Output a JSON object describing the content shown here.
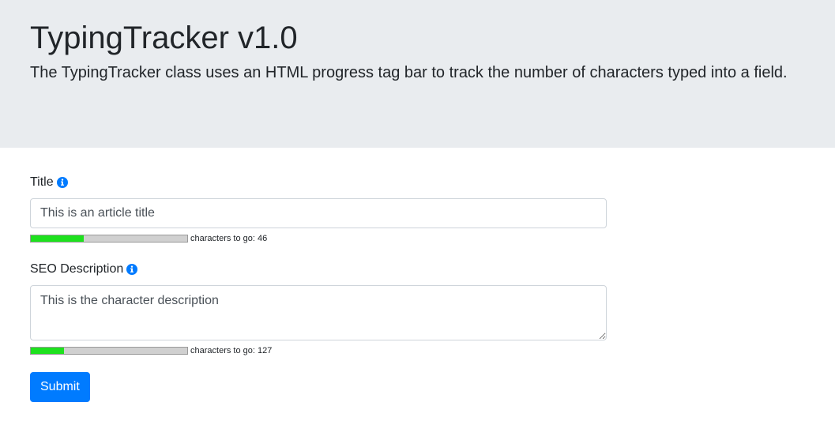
{
  "header": {
    "title": "TypingTracker v1.0",
    "description": "The TypingTracker class uses an HTML progress tag bar to track the number of characters typed into a field."
  },
  "form": {
    "title_field": {
      "label": "Title",
      "icon": "info-icon",
      "value": "This is an article title",
      "progress_fraction": 0.34,
      "counter_text": "characters to go: 46"
    },
    "seo_field": {
      "label": "SEO Description",
      "icon": "info-icon",
      "value": "This is the character description",
      "progress_fraction": 0.21,
      "counter_text": "characters to go: 127"
    },
    "submit_label": "Submit"
  },
  "colors": {
    "header_bg": "#e9ecef",
    "accent": "#007bff",
    "progress_fill": "#1ee11e",
    "progress_track": "#d0d0d0"
  }
}
